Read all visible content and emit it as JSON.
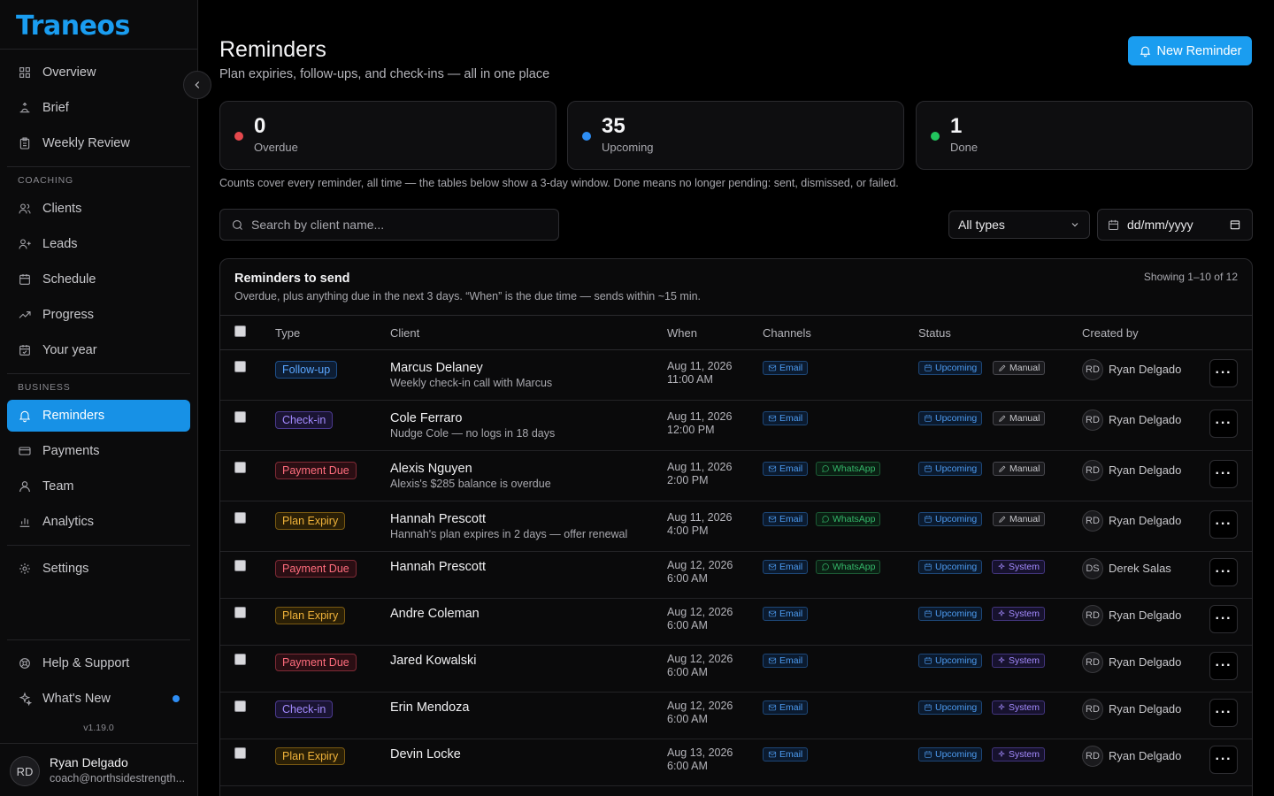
{
  "app": {
    "logo": "Traneos",
    "version": "v1.19.0"
  },
  "sidebar": {
    "items_top": [
      {
        "label": "Overview",
        "icon": "grid-icon"
      },
      {
        "label": "Brief",
        "icon": "sunrise-icon"
      },
      {
        "label": "Weekly Review",
        "icon": "clipboard-icon"
      }
    ],
    "coaching_label": "COACHING",
    "coaching": [
      {
        "label": "Clients",
        "icon": "users-icon"
      },
      {
        "label": "Leads",
        "icon": "user-plus-icon"
      },
      {
        "label": "Schedule",
        "icon": "calendar-icon"
      },
      {
        "label": "Progress",
        "icon": "trending-up-icon"
      },
      {
        "label": "Your year",
        "icon": "calendar-check-icon"
      }
    ],
    "business_label": "BUSINESS",
    "business": [
      {
        "label": "Reminders",
        "icon": "bell-icon",
        "active": true
      },
      {
        "label": "Payments",
        "icon": "credit-card-icon"
      },
      {
        "label": "Team",
        "icon": "team-icon"
      },
      {
        "label": "Analytics",
        "icon": "bar-chart-icon"
      }
    ],
    "settings": {
      "label": "Settings",
      "icon": "gear-icon"
    },
    "help": {
      "label": "Help & Support",
      "icon": "lifebuoy-icon"
    },
    "whats_new": {
      "label": "What's New",
      "icon": "sparkles-icon"
    },
    "user": {
      "initials": "RD",
      "name": "Ryan Delgado",
      "email": "coach@northsidestrength..."
    }
  },
  "header": {
    "title": "Reminders",
    "subtitle": "Plan expiries, follow-ups, and check-ins — all in one place",
    "new_button": "New Reminder"
  },
  "stats": [
    {
      "value": "0",
      "label": "Overdue",
      "color": "#e5484d"
    },
    {
      "value": "35",
      "label": "Upcoming",
      "color": "#2e8ef5"
    },
    {
      "value": "1",
      "label": "Done",
      "color": "#22c55e"
    }
  ],
  "counts_note": "Counts cover every reminder, all time — the tables below show a 3-day window. Done means no longer pending: sent, dismissed, or failed.",
  "filters": {
    "search_placeholder": "Search by client name...",
    "type_selected": "All types",
    "date_placeholder": "dd/mm/yyyy"
  },
  "table": {
    "title": "Reminders to send",
    "subtitle": "Overdue, plus anything due in the next 3 days. “When” is the due time — sends within ~15 min.",
    "showing": "Showing 1–10 of 12",
    "columns": [
      "Type",
      "Client",
      "When",
      "Channels",
      "Status",
      "Created by"
    ],
    "rows": [
      {
        "type": "Follow-up",
        "kind": "followup",
        "client": "Marcus Delaney",
        "note": "Weekly check-in call with Marcus",
        "date": "Aug 11, 2026",
        "time": "11:00 AM",
        "channels": [
          "Email"
        ],
        "status": "Upcoming",
        "source": "Manual",
        "creator_initials": "RD",
        "creator": "Ryan Delgado"
      },
      {
        "type": "Check-in",
        "kind": "checkin",
        "client": "Cole Ferraro",
        "note": "Nudge Cole — no logs in 18 days",
        "date": "Aug 11, 2026",
        "time": "12:00 PM",
        "channels": [
          "Email"
        ],
        "status": "Upcoming",
        "source": "Manual",
        "creator_initials": "RD",
        "creator": "Ryan Delgado"
      },
      {
        "type": "Payment Due",
        "kind": "payment",
        "client": "Alexis Nguyen",
        "note": "Alexis's $285 balance is overdue",
        "date": "Aug 11, 2026",
        "time": "2:00 PM",
        "channels": [
          "Email",
          "WhatsApp"
        ],
        "status": "Upcoming",
        "source": "Manual",
        "creator_initials": "RD",
        "creator": "Ryan Delgado"
      },
      {
        "type": "Plan Expiry",
        "kind": "plan",
        "client": "Hannah Prescott",
        "note": "Hannah's plan expires in 2 days — offer renewal",
        "date": "Aug 11, 2026",
        "time": "4:00 PM",
        "channels": [
          "Email",
          "WhatsApp"
        ],
        "status": "Upcoming",
        "source": "Manual",
        "creator_initials": "RD",
        "creator": "Ryan Delgado"
      },
      {
        "type": "Payment Due",
        "kind": "payment",
        "client": "Hannah Prescott",
        "note": "",
        "date": "Aug 12, 2026",
        "time": "6:00 AM",
        "channels": [
          "Email",
          "WhatsApp"
        ],
        "status": "Upcoming",
        "source": "System",
        "creator_initials": "DS",
        "creator": "Derek Salas"
      },
      {
        "type": "Plan Expiry",
        "kind": "plan",
        "client": "Andre Coleman",
        "note": "",
        "date": "Aug 12, 2026",
        "time": "6:00 AM",
        "channels": [
          "Email"
        ],
        "status": "Upcoming",
        "source": "System",
        "creator_initials": "RD",
        "creator": "Ryan Delgado"
      },
      {
        "type": "Payment Due",
        "kind": "payment",
        "client": "Jared Kowalski",
        "note": "",
        "date": "Aug 12, 2026",
        "time": "6:00 AM",
        "channels": [
          "Email"
        ],
        "status": "Upcoming",
        "source": "System",
        "creator_initials": "RD",
        "creator": "Ryan Delgado"
      },
      {
        "type": "Check-in",
        "kind": "checkin",
        "client": "Erin Mendoza",
        "note": "",
        "date": "Aug 12, 2026",
        "time": "6:00 AM",
        "channels": [
          "Email"
        ],
        "status": "Upcoming",
        "source": "System",
        "creator_initials": "RD",
        "creator": "Ryan Delgado"
      },
      {
        "type": "Plan Expiry",
        "kind": "plan",
        "client": "Devin Locke",
        "note": "",
        "date": "Aug 13, 2026",
        "time": "6:00 AM",
        "channels": [
          "Email"
        ],
        "status": "Upcoming",
        "source": "System",
        "creator_initials": "RD",
        "creator": "Ryan Delgado"
      }
    ]
  }
}
